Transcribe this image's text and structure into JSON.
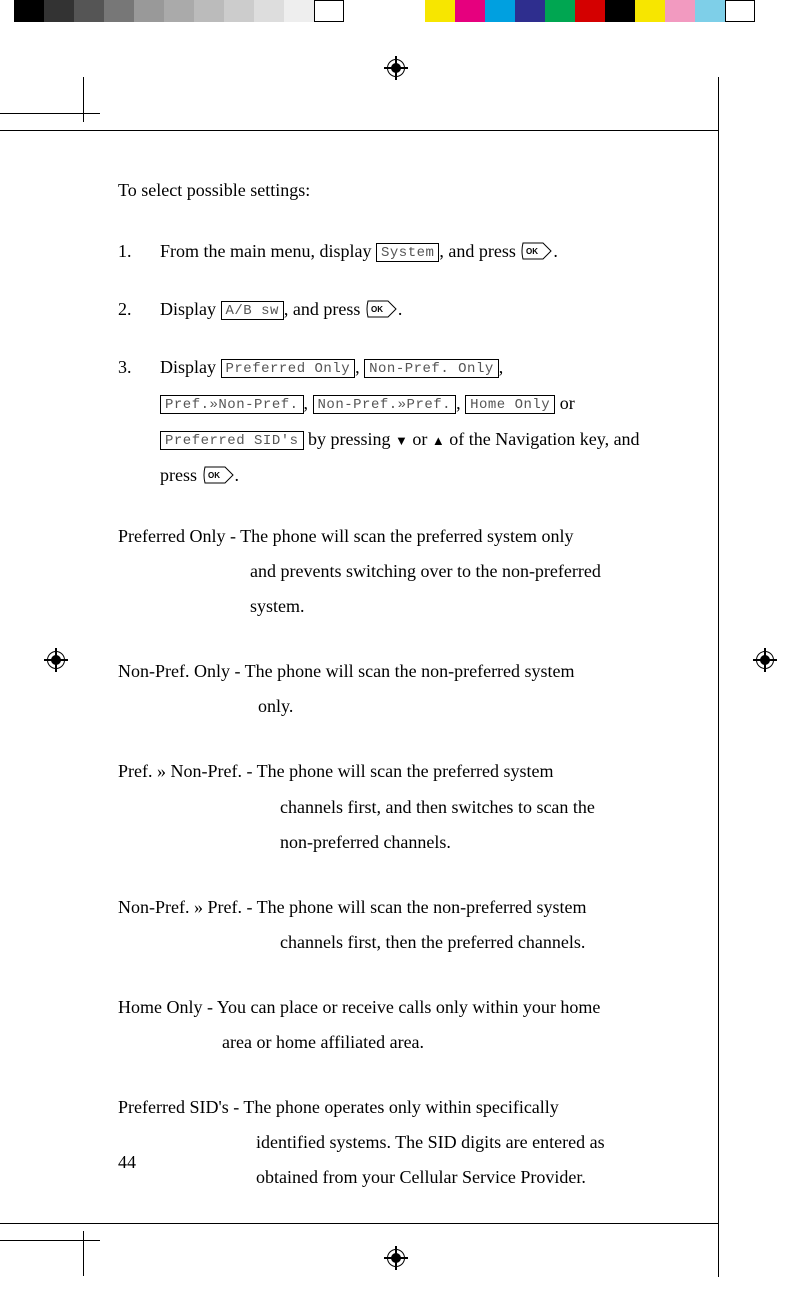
{
  "page_number": "44",
  "intro": "To select possible settings:",
  "steps": {
    "s1_num": "1.",
    "s1_a": "From the main menu, display ",
    "s1_lcd": "System",
    "s1_b": ", and press ",
    "s1_c": ".",
    "s2_num": "2.",
    "s2_a": "Display ",
    "s2_lcd": "A/B sw",
    "s2_b": ", and press ",
    "s2_c": ".",
    "s3_num": "3.",
    "s3_a": "Display ",
    "s3_lcd1": "Preferred Only",
    "s3_sep1": ", ",
    "s3_lcd2": "Non-Pref. Only",
    "s3_sep2": ",",
    "s3_lcd3": "Pref.»Non-Pref.",
    "s3_sep3": ", ",
    "s3_lcd4": "Non-Pref.»Pref.",
    "s3_sep4": ", ",
    "s3_lcd5": "Home Only",
    "s3_sep5": " or",
    "s3_lcd6": "Preferred SID's",
    "s3_b": " by pressing ",
    "s3_c": " or ",
    "s3_d": " of the Navigation key, and press ",
    "s3_e": "."
  },
  "ok_label": "OK",
  "defs": {
    "d1_label": "Preferred Only - ",
    "d1_body_a": "The phone will scan the preferred system only",
    "d1_body_b": "and prevents switching over to the non-preferred",
    "d1_body_c": "system.",
    "d2_label": "Non-Pref. Only - ",
    "d2_body_a": "The phone will scan the non-preferred system",
    "d2_body_b": "only.",
    "d3_label": "Pref. » Non-Pref. - ",
    "d3_body_a": "The phone will scan the preferred system",
    "d3_body_b": "channels first, and then switches to scan the",
    "d3_body_c": "non-preferred channels.",
    "d4_label": "Non-Pref. » Pref. - ",
    "d4_body_a": "The phone will scan the non-preferred system",
    "d4_body_b": "channels first, then the preferred channels.",
    "d5_label": "Home Only - ",
    "d5_body_a": "You can place or receive calls only within your home",
    "d5_body_b": "area or home affiliated area.",
    "d6_label": "Preferred SID's - ",
    "d6_body_a": "The phone operates only within specifically",
    "d6_body_b": "identified systems. The SID digits are entered as",
    "d6_body_c": "obtained from your Cellular Service Provider."
  },
  "colorbars": {
    "left": [
      "#000000",
      "#333333",
      "#555555",
      "#777777",
      "#999999",
      "#aaaaaa",
      "#bbbbbb",
      "#cccccc",
      "#dddddd",
      "#eeeeee",
      "#ffffff"
    ],
    "right": [
      "#f7e600",
      "#e6007e",
      "#00a0e0",
      "#2e2e8e",
      "#00a651",
      "#d40000",
      "#000000",
      "#f7e600",
      "#f29ac0",
      "#7ecfe8",
      "#ffffff"
    ]
  }
}
